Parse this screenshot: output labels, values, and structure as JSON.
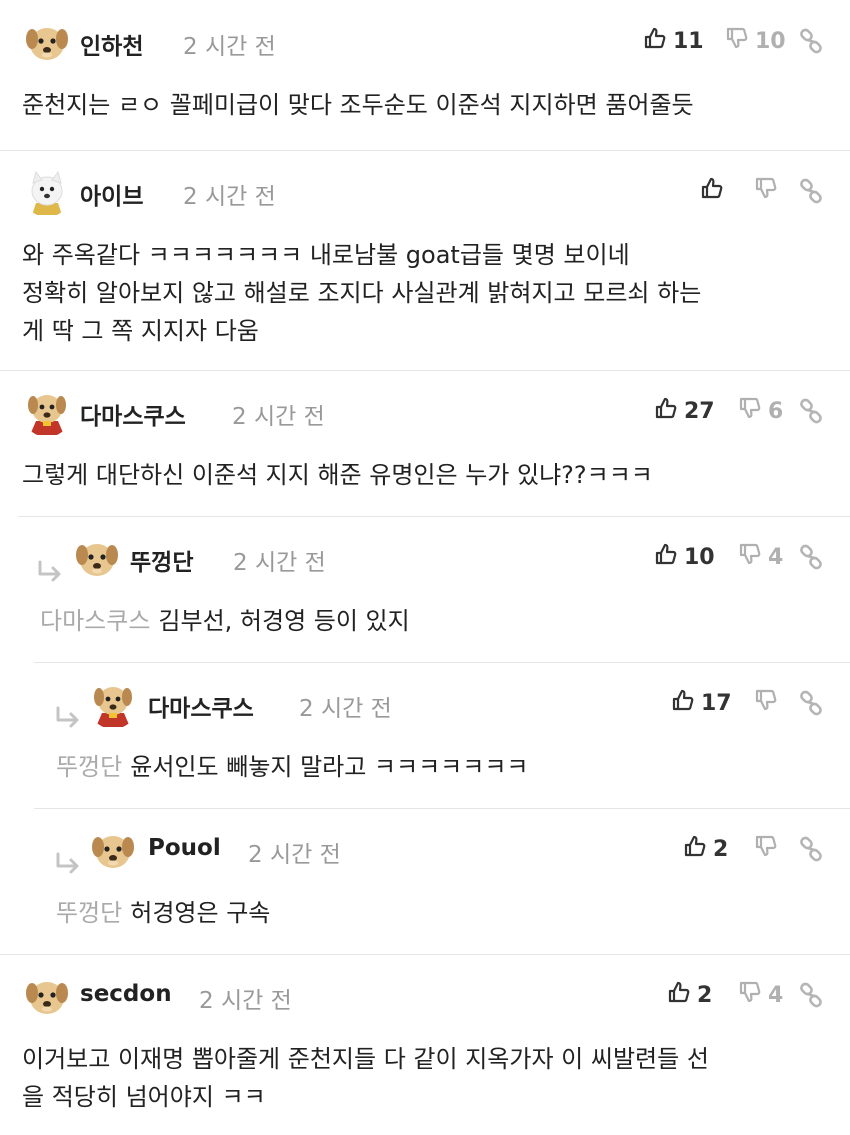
{
  "colors": {
    "mention": "#aaaaaa",
    "time": "#999999",
    "separator": "#e6e6e6",
    "downvote": "#b0b0b0"
  },
  "comments": [
    {
      "author": "인하천",
      "time": "2 시간 전",
      "upvotes": "11",
      "downvotes": "10",
      "mention": "",
      "text": [
        "준천지는 ㄹㅇ 꼴페미급이 맞다 조두순도 이준석 지지하면 품어줄듯"
      ],
      "avatar": "puppy-avatar",
      "depth": 0
    },
    {
      "author": "아이브",
      "time": "2 시간 전",
      "upvotes": "",
      "downvotes": "",
      "mention": "",
      "text": [
        "와 주옥같다 ㅋㅋㅋㅋㅋㅋㅋ 내로남불 goat급들 몇명 보이네",
        "정확히 알아보지 않고 해설로 조지다 사실관계 밝혀지고 모르쇠 하는",
        "게 딱 그 쪽 지지자 다움"
      ],
      "avatar": "white-dog-avatar",
      "depth": 0
    },
    {
      "author": "다마스쿠스",
      "time": "2 시간 전",
      "upvotes": "27",
      "downvotes": "6",
      "mention": "",
      "text": [
        "그렇게 대단하신 이준석 지지 해준 유명인은 누가 있냐??ㅋㅋㅋ"
      ],
      "avatar": "cape-puppy-avatar",
      "depth": 0
    },
    {
      "author": "뚜껑단",
      "time": "2 시간 전",
      "upvotes": "10",
      "downvotes": "4",
      "mention": "다마스쿠스",
      "text": [
        "김부선, 허경영 등이 있지"
      ],
      "avatar": "puppy-avatar",
      "depth": 1
    },
    {
      "author": "다마스쿠스",
      "time": "2 시간 전",
      "upvotes": "17",
      "downvotes": "",
      "mention": "뚜껑단",
      "text": [
        "윤서인도 빼놓지 말라고 ㅋㅋㅋㅋㅋㅋㅋ"
      ],
      "avatar": "cape-puppy-avatar",
      "depth": 2
    },
    {
      "author": "Pouol",
      "time": "2 시간 전",
      "upvotes": "2",
      "downvotes": "",
      "mention": "뚜껑단",
      "text": [
        "허경영은 구속"
      ],
      "avatar": "puppy-avatar",
      "depth": 2
    },
    {
      "author": "secdon",
      "time": "2 시간 전",
      "upvotes": "2",
      "downvotes": "4",
      "mention": "",
      "text": [
        "이거보고 이재명 뽑아줄게 준천지들 다 같이 지옥가자 이 씨발련들 선",
        "을 적당히 넘어야지 ㅋㅋ"
      ],
      "avatar": "puppy-avatar",
      "depth": 0
    }
  ]
}
